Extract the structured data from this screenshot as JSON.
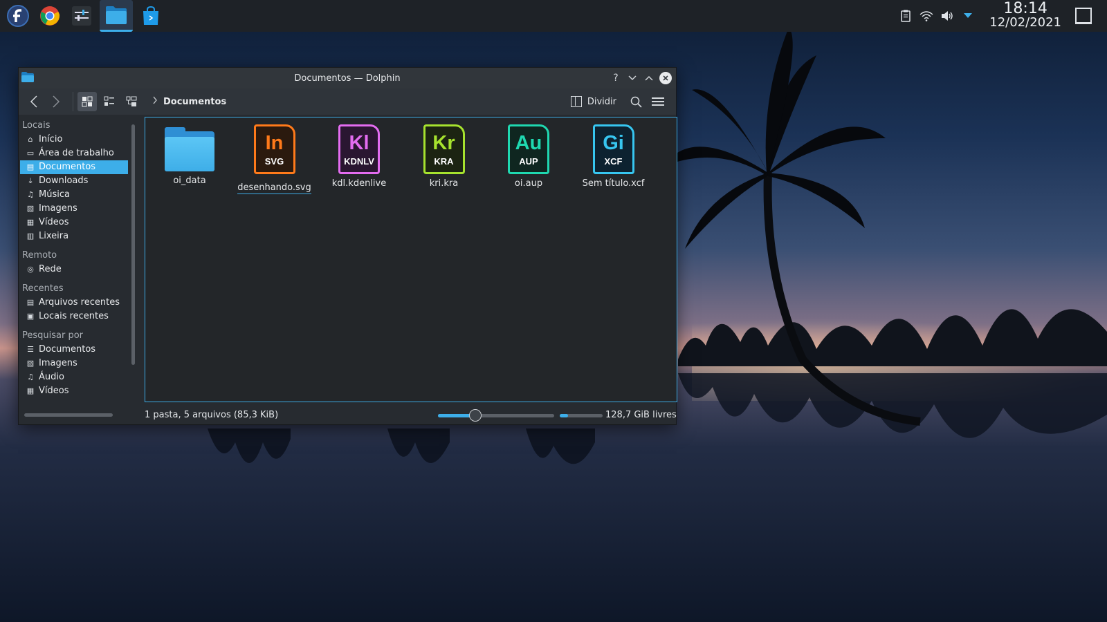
{
  "taskbar": {
    "apps": [
      {
        "name": "fedora-launcher-icon"
      },
      {
        "name": "chrome-icon"
      },
      {
        "name": "settings-icon"
      },
      {
        "name": "dolphin-icon",
        "active": true
      },
      {
        "name": "discover-store-icon"
      }
    ],
    "tray": [
      "clipboard-icon",
      "wifi-icon",
      "volume-icon",
      "tray-expand-icon"
    ],
    "clock_time": "18:14",
    "clock_date": "12/02/2021"
  },
  "window": {
    "title": "Documentos — Dolphin",
    "titlebar_buttons": {
      "help": "?",
      "minimize": "⌄",
      "maximize": "⌃",
      "close": "✕"
    },
    "toolbar": {
      "breadcrumb": "Documentos",
      "split_label": "Dividir"
    },
    "sidebar": {
      "sections": [
        {
          "title": "Locais",
          "items": [
            {
              "label": "Início",
              "icon": "home-icon"
            },
            {
              "label": "Área de trabalho",
              "icon": "desktop-icon"
            },
            {
              "label": "Documentos",
              "icon": "documents-icon",
              "active": true
            },
            {
              "label": "Downloads",
              "icon": "download-icon"
            },
            {
              "label": "Música",
              "icon": "music-icon"
            },
            {
              "label": "Imagens",
              "icon": "image-icon"
            },
            {
              "label": "Vídeos",
              "icon": "video-icon"
            },
            {
              "label": "Lixeira",
              "icon": "trash-icon"
            }
          ]
        },
        {
          "title": "Remoto",
          "items": [
            {
              "label": "Rede",
              "icon": "network-icon"
            }
          ]
        },
        {
          "title": "Recentes",
          "items": [
            {
              "label": "Arquivos recentes",
              "icon": "recent-files-icon"
            },
            {
              "label": "Locais recentes",
              "icon": "recent-places-icon"
            }
          ]
        },
        {
          "title": "Pesquisar por",
          "items": [
            {
              "label": "Documentos",
              "icon": "documents-search-icon"
            },
            {
              "label": "Imagens",
              "icon": "image-search-icon"
            },
            {
              "label": "Áudio",
              "icon": "audio-search-icon"
            },
            {
              "label": "Vídeos",
              "icon": "video-search-icon"
            }
          ]
        }
      ]
    },
    "files": [
      {
        "name": "oi_data",
        "type": "folder"
      },
      {
        "name": "desenhando.svg",
        "big": "In",
        "small": "SVG",
        "color": "#ff7a1a",
        "bg": "#2b1a0e"
      },
      {
        "name": "kdl.kdenlive",
        "big": "Kl",
        "small": "KDNLV",
        "color": "#e36cf0",
        "bg": "#2a1631"
      },
      {
        "name": "kri.kra",
        "big": "Kr",
        "small": "KRA",
        "color": "#a6e22e",
        "bg": "#1c2412"
      },
      {
        "name": "oi.aup",
        "big": "Au",
        "small": "AUP",
        "color": "#1fd8b0",
        "bg": "#0f2620"
      },
      {
        "name": "Sem título.xcf",
        "big": "Gi",
        "small": "XCF",
        "color": "#37c6f0",
        "bg": "#0d2230"
      }
    ],
    "status": {
      "summary": "1 pasta, 5 arquivos (85,3 KiB)",
      "zoom_level": 0.32,
      "free_space": "128,7 GiB livres",
      "used_fraction": 0.19
    }
  },
  "colors": {
    "accent": "#3daee9",
    "taskbar": "#1e2227",
    "window": "#272b30"
  }
}
